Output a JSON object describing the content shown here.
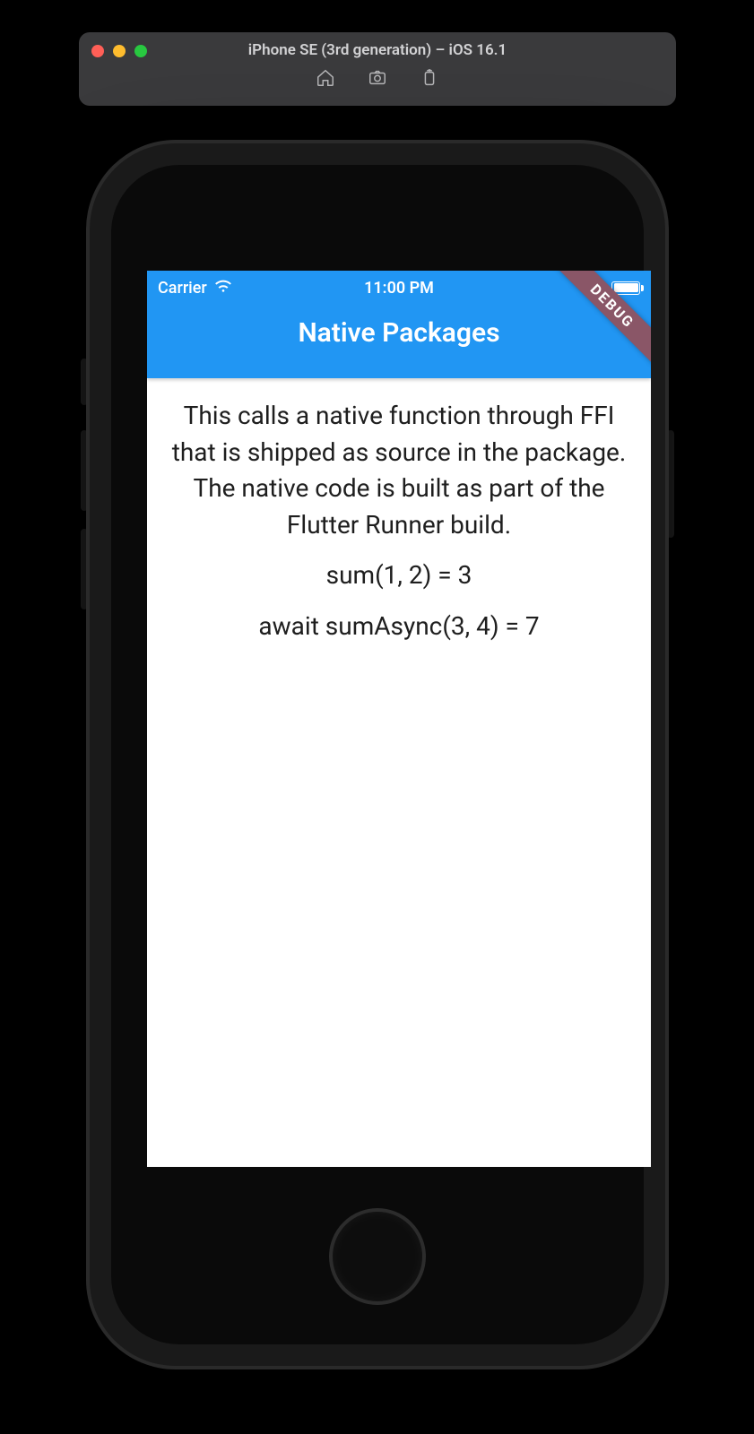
{
  "simulator": {
    "title": "iPhone SE (3rd generation) – iOS 16.1",
    "toolbar_icons": [
      "home-icon",
      "screenshot-icon",
      "rotate-icon"
    ]
  },
  "status_bar": {
    "carrier": "Carrier",
    "time": "11:00 PM"
  },
  "appbar": {
    "title": "Native Packages",
    "debug_label": "DEBUG"
  },
  "body": {
    "description": "This calls a native function through FFI that is shipped as source in the package. The native code is built as part of the Flutter Runner build.",
    "result_sync": "sum(1, 2) = 3",
    "result_async": "await sumAsync(3, 4) = 7"
  }
}
